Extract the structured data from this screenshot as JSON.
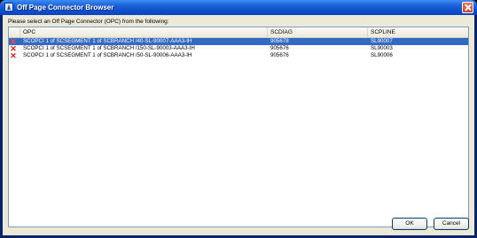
{
  "window": {
    "title": "Off Page Connector Browser"
  },
  "prompt": "Please select an Off Page Connector (OPC) from the following:",
  "table": {
    "columns": [
      "",
      "OPC",
      "SCDIAG",
      "SCPLINE"
    ],
    "rows": [
      {
        "status_icon": "error-x-icon",
        "opc": "SCOPCI 1 of SCSEGMENT 1 of SCBRANCH /40-SL-90007-AAA3-IH",
        "scdiag": "905678",
        "scpline": "SL90007",
        "selected": true
      },
      {
        "status_icon": "error-x-icon",
        "opc": "SCOPCI 1 of SCSEGMENT 1 of SCBRANCH /150-SL-90003-AAA3-IH",
        "scdiag": "905676",
        "scpline": "SL90003",
        "selected": false
      },
      {
        "status_icon": "error-x-icon",
        "opc": "SCOPCI 1 of SCSEGMENT 1 of SCBRANCH /50-SL-90006-AAA3-IH",
        "scdiag": "905676",
        "scpline": "SL90006",
        "selected": false
      }
    ]
  },
  "buttons": {
    "ok": "OK",
    "cancel": "Cancel"
  },
  "colors": {
    "selection": "#316ac5",
    "error_icon": "#e02018",
    "dialog_bg": "#ece9d8"
  }
}
